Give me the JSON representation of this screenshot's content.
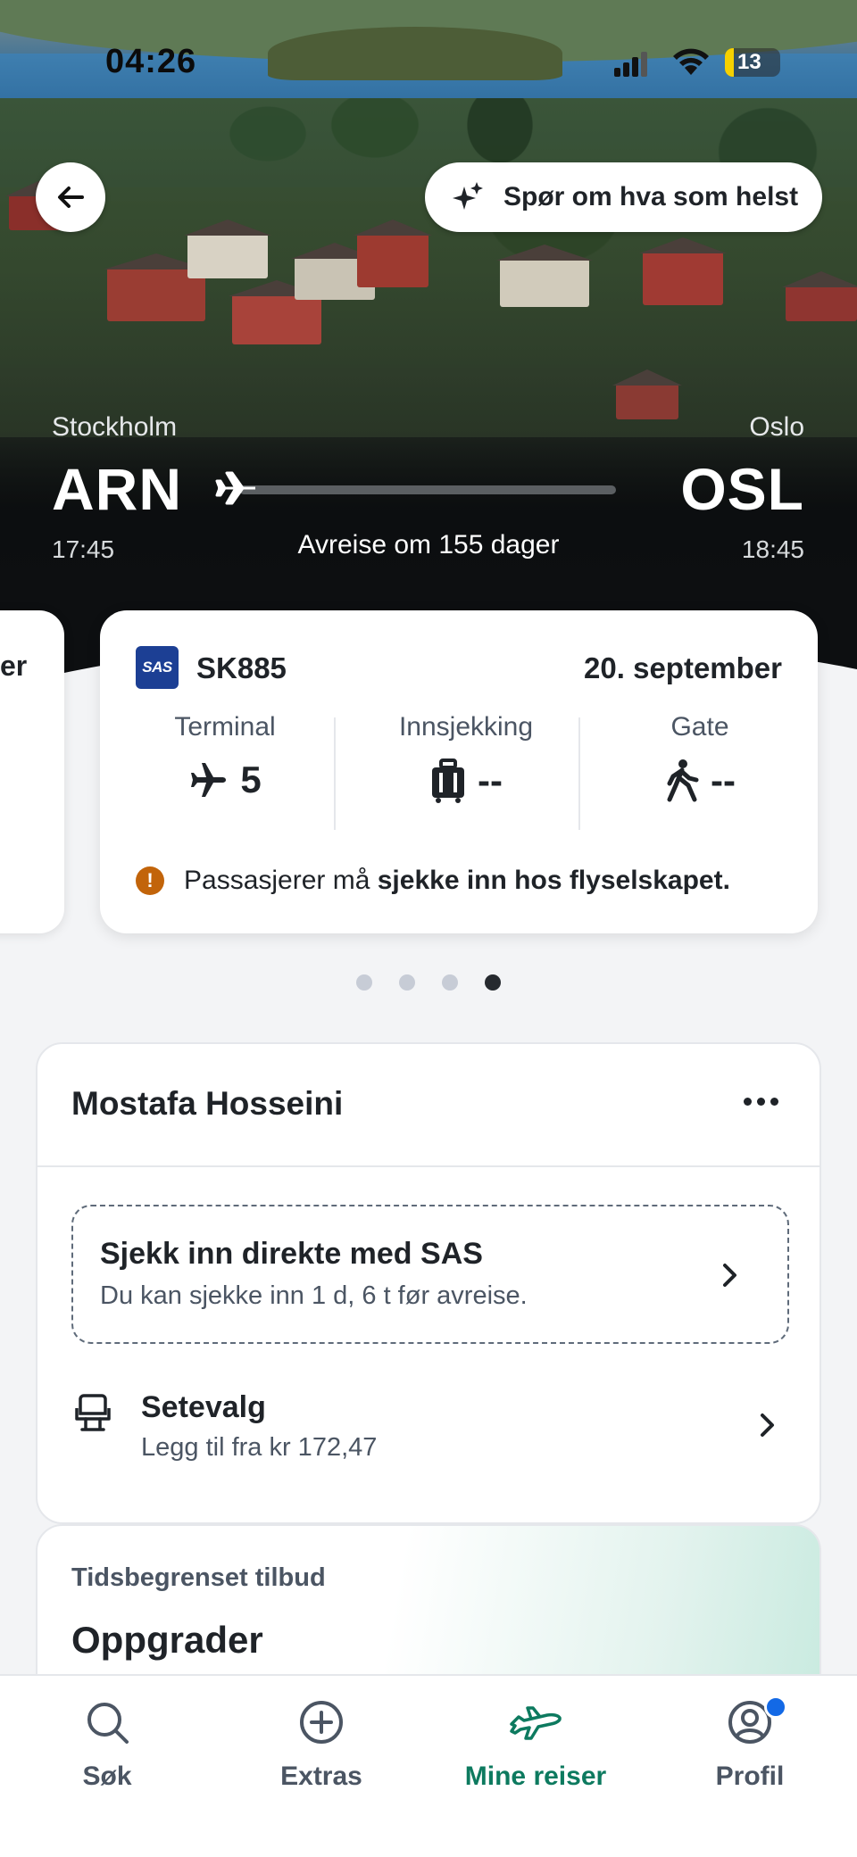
{
  "status_bar": {
    "time": "04:26",
    "battery": "13"
  },
  "header": {
    "ask_label": "Spør om hva som helst"
  },
  "route": {
    "from_city": "Stockholm",
    "from_code": "ARN",
    "from_time": "17:45",
    "to_city": "Oslo",
    "to_code": "OSL",
    "to_time": "18:45",
    "departure_info": "Avreise om 155 dager"
  },
  "flight_card": {
    "peek_text": "er",
    "airline_logo_text": "SAS",
    "flight_number": "SK885",
    "date": "20. september",
    "terminal_label": "Terminal",
    "terminal_value": "5",
    "checkin_label": "Innsjekking",
    "checkin_value": "--",
    "gate_label": "Gate",
    "gate_value": "--",
    "notice_prefix": "Passasjerer må ",
    "notice_bold": "sjekke inn hos flyselskapet."
  },
  "pagination": {
    "count": 4,
    "active_index": 3
  },
  "passenger": {
    "name": "Mostafa Hosseini",
    "checkin_title": "Sjekk inn direkte med SAS",
    "checkin_sub": "Du kan sjekke inn 1 d, 6 t før avreise.",
    "seat_title": "Setevalg",
    "seat_sub": "Legg til fra kr 172,47"
  },
  "offer": {
    "kicker": "Tidsbegrenset tilbud",
    "title": "Oppgrader"
  },
  "tabbar": {
    "items": [
      {
        "label": "Søk",
        "icon": "search-icon"
      },
      {
        "label": "Extras",
        "icon": "plus-circle-icon"
      },
      {
        "label": "Mine reiser",
        "icon": "airplane-icon"
      },
      {
        "label": "Profil",
        "icon": "profile-icon"
      }
    ],
    "active": "Mine reiser"
  },
  "colors": {
    "accent_green": "#0d7a5f",
    "sas_blue": "#1c3f94",
    "warning_orange": "#c2640a",
    "badge_blue": "#1369e6"
  }
}
